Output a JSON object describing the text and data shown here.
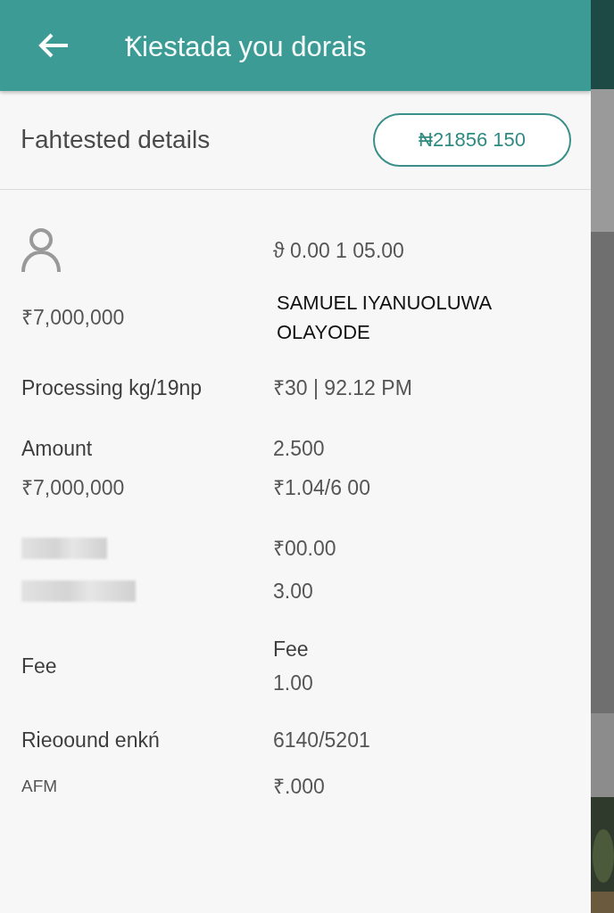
{
  "header": {
    "title": "Ꝁiestada you dorais"
  },
  "subheader": {
    "title": "Ꮀahtested details",
    "amount_button": "₦21856 150"
  },
  "rows": [
    {
      "left": [
        {
          "kind": "avatar"
        }
      ],
      "right": [
        {
          "kind": "text",
          "text": "ϑ 0.00 1 05.00"
        }
      ]
    },
    {
      "left": [
        {
          "kind": "text",
          "text": "₹7,000,000"
        }
      ],
      "right": [
        {
          "kind": "name",
          "text": "SAMUEL  IYANUOLUWA OLAYODE"
        }
      ]
    },
    {
      "left": [
        {
          "kind": "label",
          "text": "Processing kg/19np"
        }
      ],
      "right": [
        {
          "kind": "text",
          "text": "₹30 | 92.12 PM"
        }
      ]
    },
    {
      "left": [
        {
          "kind": "label",
          "text": "Amount"
        },
        {
          "kind": "text",
          "text": "₹7,000,000"
        }
      ],
      "right": [
        {
          "kind": "text",
          "text": "2.500"
        },
        {
          "kind": "text",
          "text": "₹1.04/6 00"
        }
      ]
    },
    {
      "left": [
        {
          "kind": "redacted"
        },
        {
          "kind": "redacted"
        }
      ],
      "right": [
        {
          "kind": "text",
          "text": "₹00.00"
        },
        {
          "kind": "text",
          "text": "3.00"
        }
      ]
    },
    {
      "left": [
        {
          "kind": "label",
          "text": "Fee"
        }
      ],
      "right": [
        {
          "kind": "label",
          "text": "Fee"
        },
        {
          "kind": "text",
          "text": "1.00"
        }
      ]
    },
    {
      "left": [
        {
          "kind": "label",
          "text": "Rieoound enkń"
        }
      ],
      "right": [
        {
          "kind": "text",
          "text": "6140/5201"
        }
      ]
    },
    {
      "left": [
        {
          "kind": "small",
          "text": "AFM"
        }
      ],
      "right": [
        {
          "kind": "text",
          "text": "₹.000"
        }
      ]
    }
  ]
}
